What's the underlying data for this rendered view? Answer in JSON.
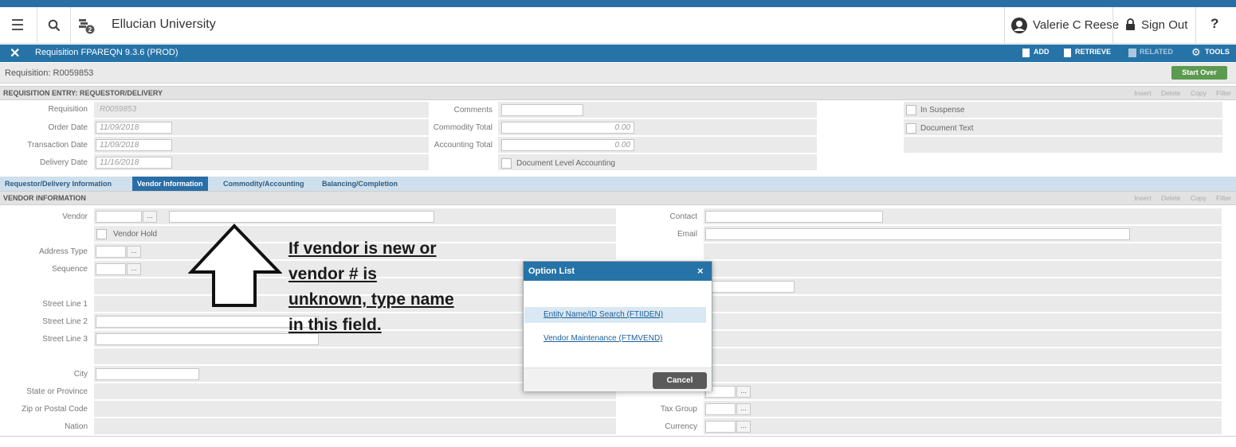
{
  "topbar": {
    "app_title": "Ellucian University",
    "user_name": "Valerie C Reese",
    "sign_out": "Sign Out",
    "help": "?",
    "notification_count": "2"
  },
  "formbar": {
    "title": "Requisition FPAREQN 9.3.6 (PROD)",
    "add": "ADD",
    "retrieve": "RETRIEVE",
    "related": "RELATED",
    "tools": "TOOLS"
  },
  "keyblock": {
    "label": "Requisition: R0059853",
    "start_over": "Start Over"
  },
  "section_tools": {
    "insert": "Insert",
    "delete": "Delete",
    "copy": "Copy",
    "filter": "Filter"
  },
  "req_entry": {
    "title": "REQUISITION ENTRY: REQUESTOR/DELIVERY",
    "requisition_label": "Requisition",
    "requisition_value": "R0059853",
    "order_date_label": "Order Date",
    "order_date_value": "11/09/2018",
    "transaction_date_label": "Transaction Date",
    "transaction_date_value": "11/09/2018",
    "delivery_date_label": "Delivery Date",
    "delivery_date_value": "11/16/2018",
    "comments_label": "Comments",
    "commodity_total_label": "Commodity Total",
    "commodity_total_value": "0.00",
    "accounting_total_label": "Accounting Total",
    "accounting_total_value": "0.00",
    "doc_level_accounting": "Document Level Accounting",
    "in_suspense": "In Suspense",
    "document_text": "Document Text"
  },
  "tabs": [
    {
      "label": "Requestor/Delivery Information"
    },
    {
      "label": "Vendor Information"
    },
    {
      "label": "Commodity/Accounting"
    },
    {
      "label": "Balancing/Completion"
    }
  ],
  "vendor": {
    "title": "VENDOR INFORMATION",
    "vendor_label": "Vendor",
    "vendor_hold": "Vendor Hold",
    "address_type_label": "Address Type",
    "sequence_label": "Sequence",
    "street1_label": "Street Line 1",
    "street2_label": "Street Line 2",
    "street3_label": "Street Line 3",
    "city_label": "City",
    "state_label": "State or Province",
    "zip_label": "Zip or Postal Code",
    "nation_label": "Nation",
    "contact_label": "Contact",
    "email_label": "Email",
    "tax_group_label": "Tax Group",
    "currency_label": "Currency",
    "lov": "..."
  },
  "annotation": {
    "text": "If vendor is new or vendor # is unknown, type name in this field."
  },
  "dialog": {
    "title": "Option List",
    "close": "×",
    "options": [
      {
        "label": "Entity Name/ID Search (FTIIDEN)"
      },
      {
        "label": "Vendor Maintenance (FTMVEND)"
      }
    ],
    "cancel": "Cancel"
  }
}
